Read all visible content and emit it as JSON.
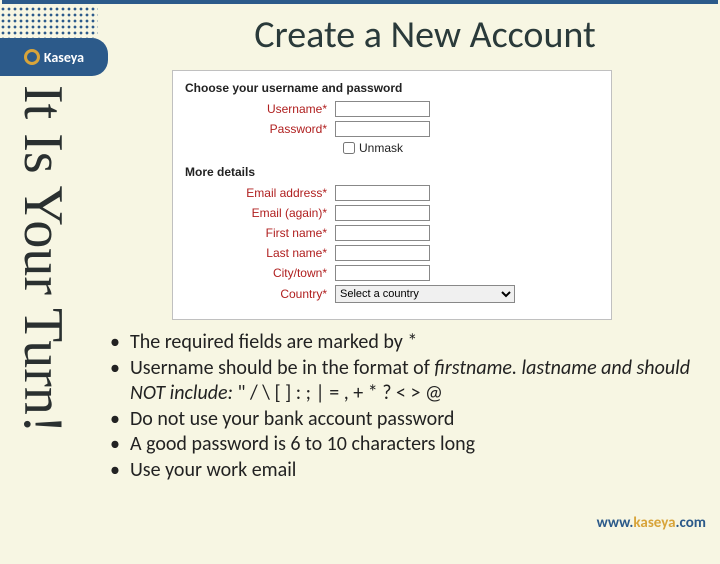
{
  "brand": {
    "name": "Kaseya",
    "url_prefix": "www.",
    "url_main": "kaseya",
    "url_suffix": ".com"
  },
  "title": "Create a New Account",
  "sidebar_text": "It Is Your Turn!",
  "form": {
    "section1_title": "Choose your username and password",
    "username_label": "Username*",
    "password_label": "Password*",
    "unmask_label": "Unmask",
    "section2_title": "More details",
    "email_label": "Email address*",
    "email2_label": "Email (again)*",
    "firstname_label": "First name*",
    "lastname_label": "Last name*",
    "city_label": "City/town*",
    "country_label": "Country*",
    "country_placeholder": "Select a country"
  },
  "bullets": {
    "b1": "The required fields are marked by *",
    "b2a": "Username should be in the format of ",
    "b2b": "firstname. lastname and should NOT include:",
    "b2c": " \" / \\ [ ] : ; | = , + * ? < > @",
    "b3": "Do not use your bank account password",
    "b4": "A good password is 6 to 10 characters long",
    "b5": "Use your work email"
  }
}
